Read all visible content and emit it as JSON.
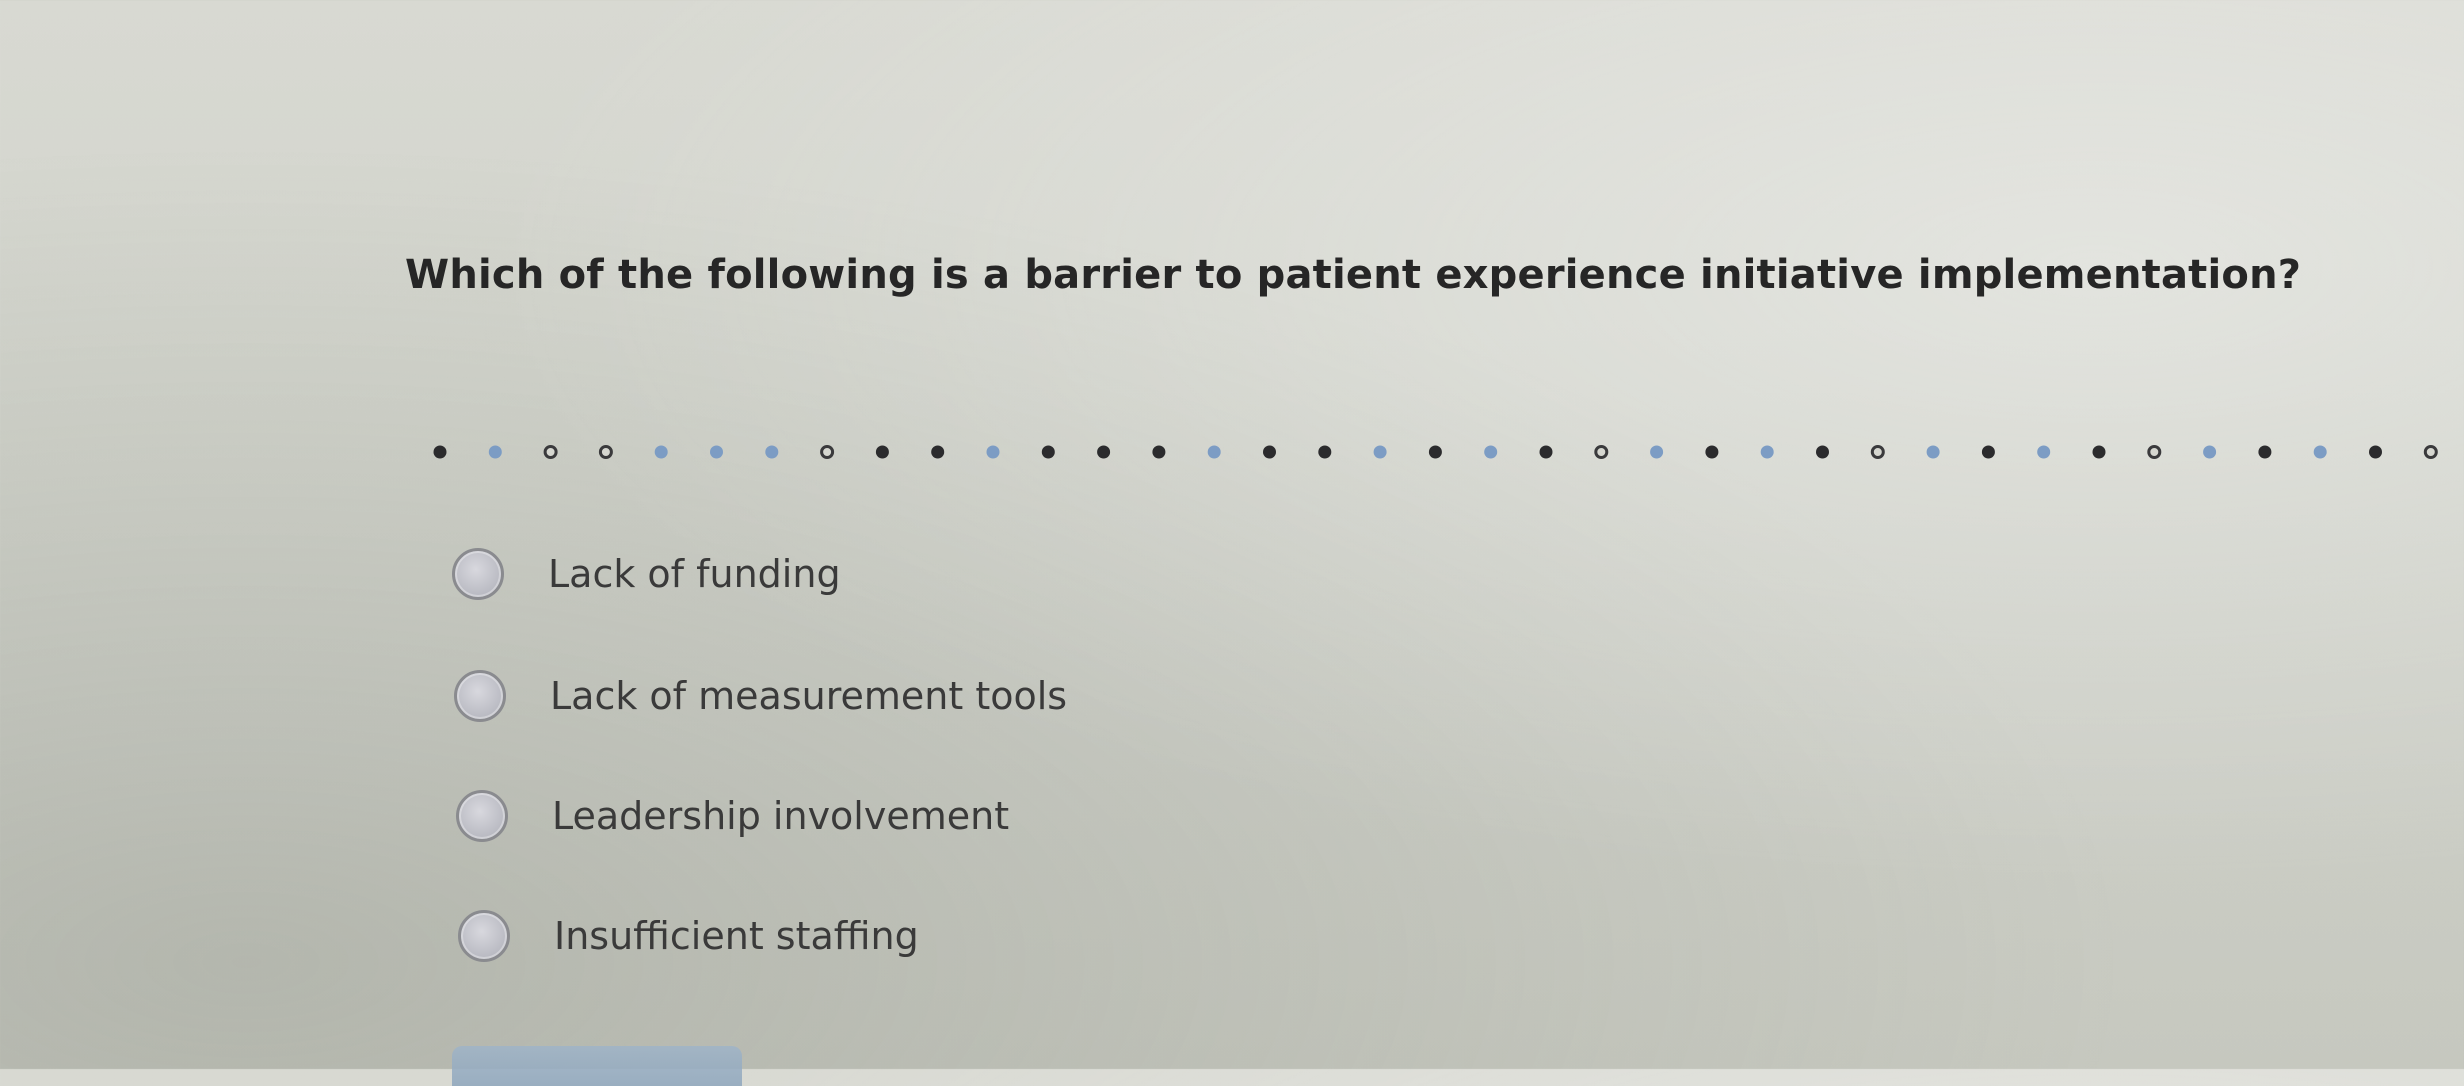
{
  "question": {
    "text": "Which of the following is a barrier to patient experience initiative implementation?"
  },
  "options": [
    {
      "label": "Lack of funding",
      "selected": false
    },
    {
      "label": "Lack of measurement tools",
      "selected": false
    },
    {
      "label": "Leadership involvement",
      "selected": false
    },
    {
      "label": "Insufficient staffing",
      "selected": false
    }
  ],
  "divider": {
    "pattern": [
      "solid",
      "blue",
      "hollow",
      "hollow",
      "blue",
      "blue",
      "blue",
      "hollow",
      "solid",
      "solid",
      "blue",
      "solid",
      "solid",
      "solid",
      "blue",
      "solid",
      "solid",
      "blue",
      "solid",
      "blue",
      "solid",
      "hollow",
      "blue",
      "solid",
      "blue",
      "solid",
      "hollow",
      "blue",
      "solid",
      "blue",
      "solid",
      "hollow",
      "blue",
      "solid",
      "blue",
      "solid",
      "hollow"
    ],
    "colors": {
      "solid": "#2b2b2d",
      "blue": "#7c9cc4",
      "hollow_stroke": "#3a3a3c",
      "hollow_fill": "#d6d7d0"
    }
  }
}
